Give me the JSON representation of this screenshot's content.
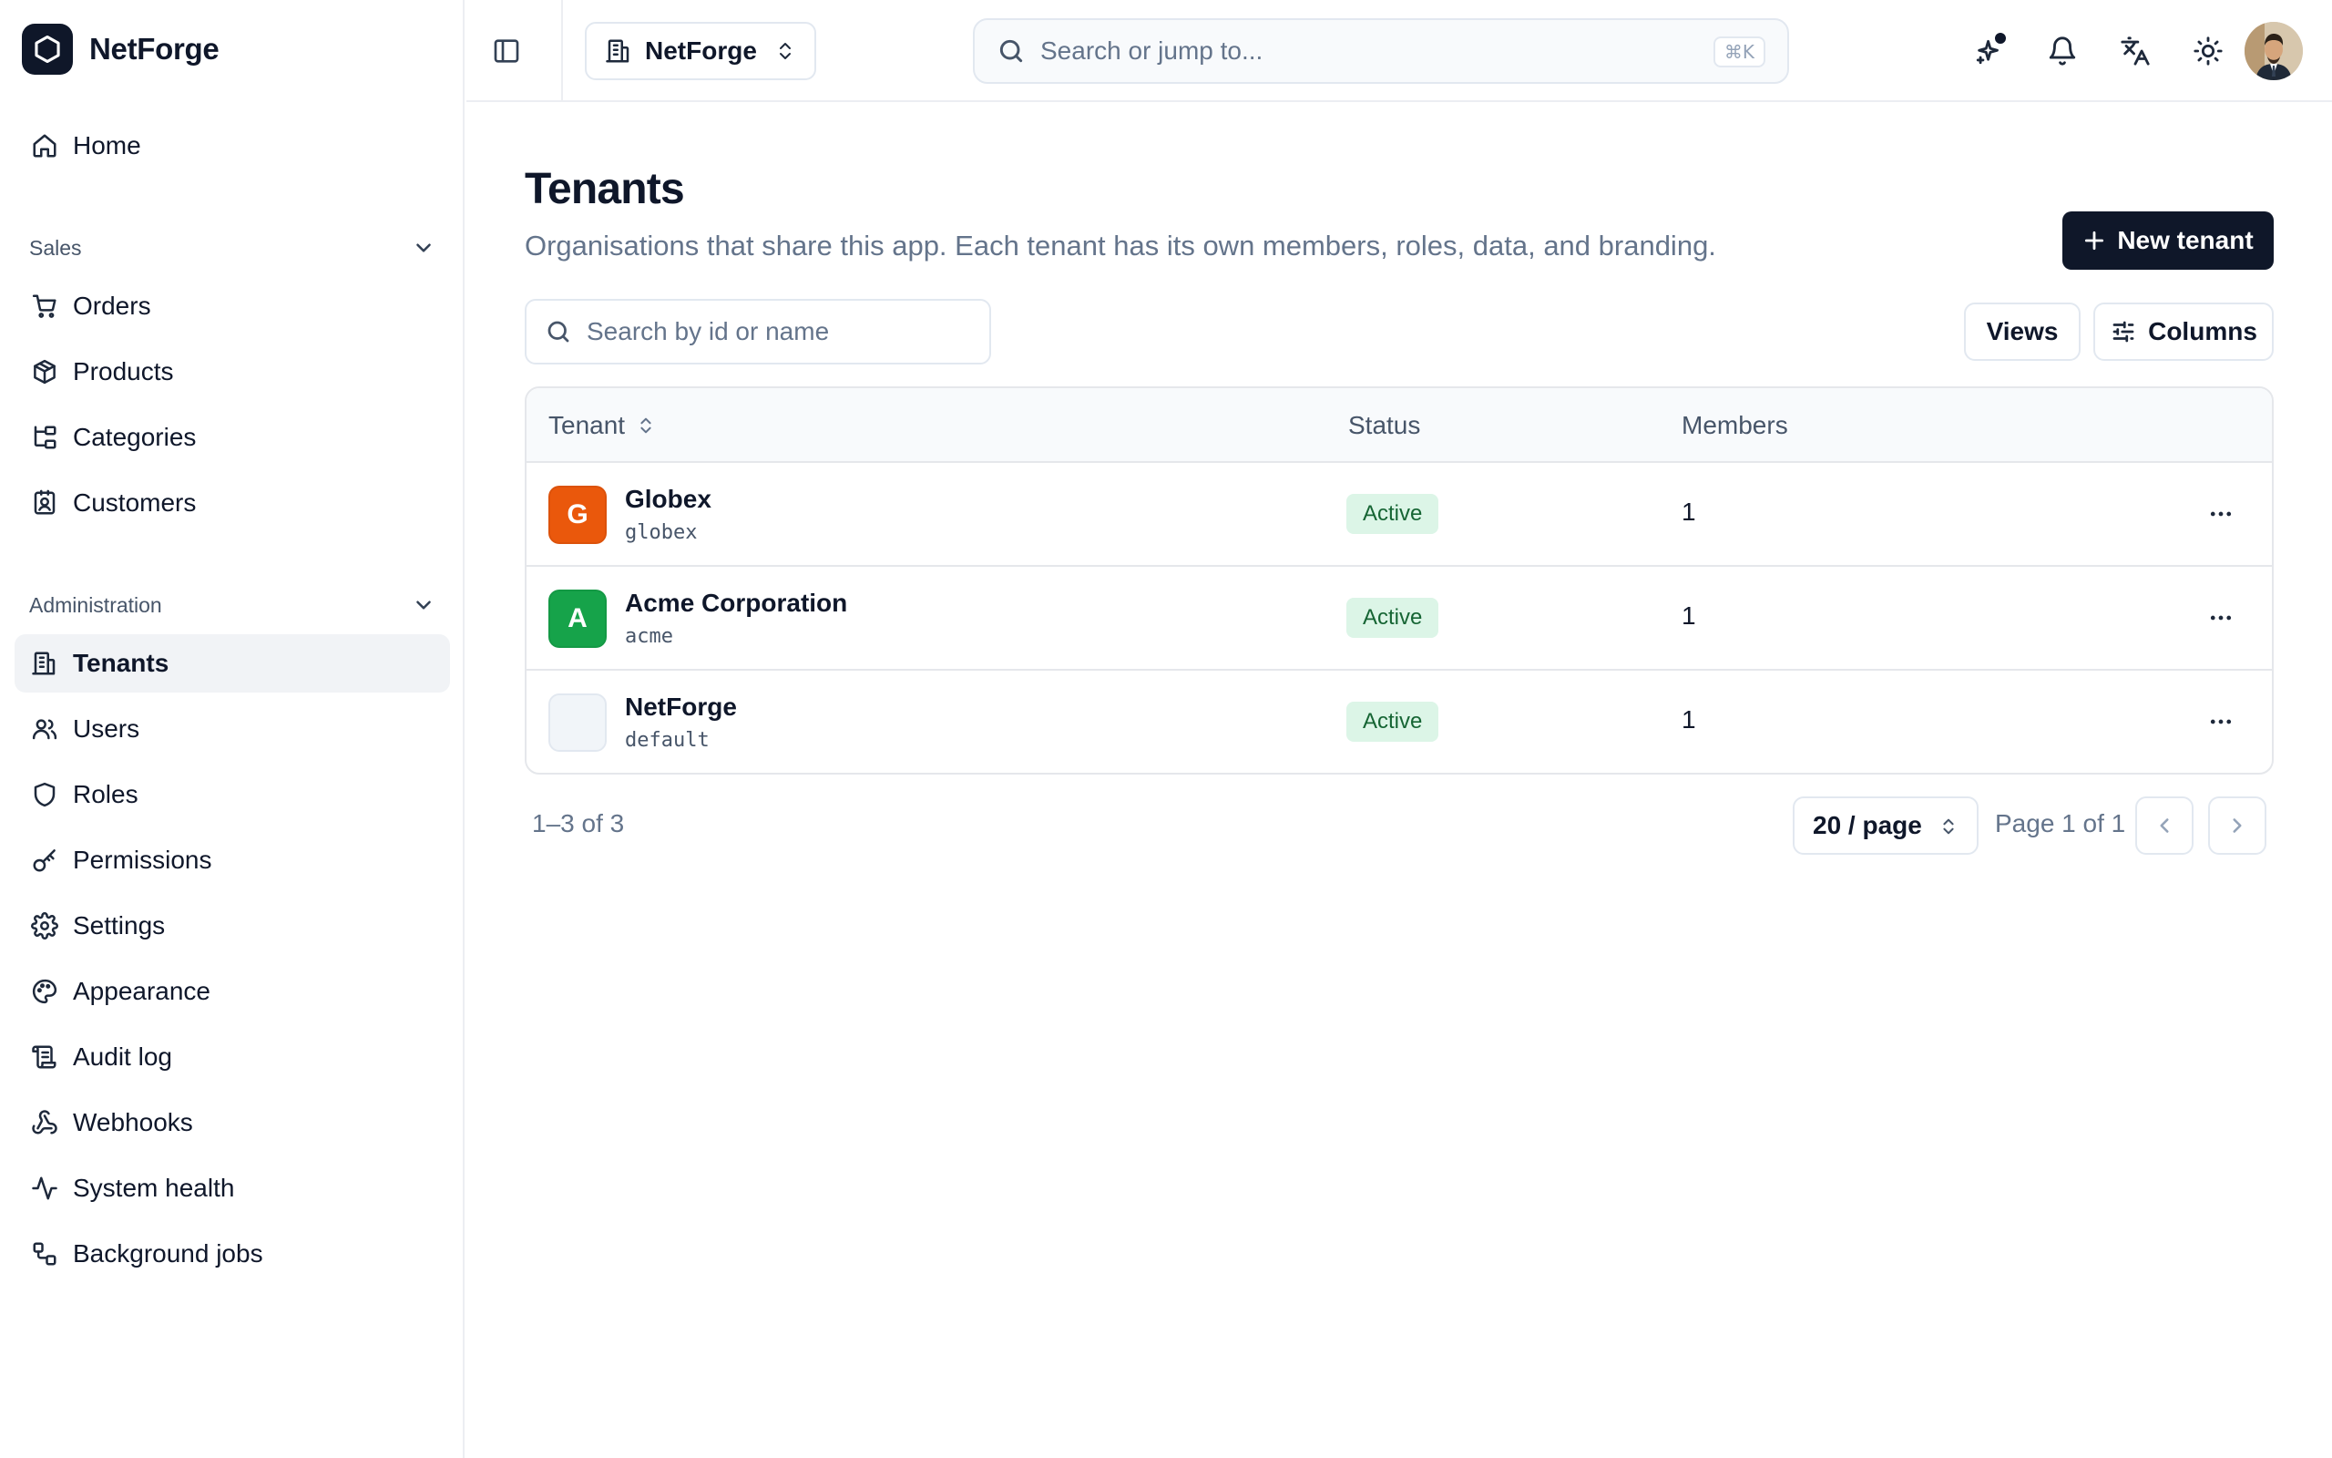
{
  "app": {
    "name": "NetForge"
  },
  "sidebar": {
    "home": {
      "label": "Home",
      "icon": "home-icon"
    },
    "sections": [
      {
        "label": "Sales",
        "items": [
          {
            "label": "Orders",
            "icon": "cart-icon"
          },
          {
            "label": "Products",
            "icon": "package-icon"
          },
          {
            "label": "Categories",
            "icon": "folder-tree-icon"
          },
          {
            "label": "Customers",
            "icon": "contact-icon"
          }
        ]
      },
      {
        "label": "Administration",
        "items": [
          {
            "label": "Tenants",
            "icon": "building-icon",
            "active": true
          },
          {
            "label": "Users",
            "icon": "users-icon"
          },
          {
            "label": "Roles",
            "icon": "shield-icon"
          },
          {
            "label": "Permissions",
            "icon": "key-icon"
          },
          {
            "label": "Settings",
            "icon": "gear-icon"
          },
          {
            "label": "Appearance",
            "icon": "palette-icon"
          },
          {
            "label": "Audit log",
            "icon": "scroll-icon"
          },
          {
            "label": "Webhooks",
            "icon": "webhook-icon"
          },
          {
            "label": "System health",
            "icon": "activity-icon"
          },
          {
            "label": "Background jobs",
            "icon": "workflow-icon"
          }
        ]
      }
    ]
  },
  "topbar": {
    "tenant_switcher": "NetForge",
    "search_placeholder": "Search or jump to...",
    "search_shortcut": "⌘K",
    "icons": [
      "sparkles-icon",
      "bell-icon",
      "languages-icon",
      "sun-icon",
      "user-avatar"
    ]
  },
  "page": {
    "title": "Tenants",
    "subtitle": "Organisations that share this app. Each tenant has its own members, roles, data, and branding.",
    "new_button": "New tenant",
    "search_placeholder": "Search by id or name",
    "views_button": "Views",
    "columns_button": "Columns"
  },
  "table": {
    "columns": [
      "Tenant",
      "Status",
      "Members"
    ],
    "rows": [
      {
        "name": "Globex",
        "id": "globex",
        "initial": "G",
        "color": "#ea580c",
        "status": "Active",
        "members": "1"
      },
      {
        "name": "Acme Corporation",
        "id": "acme",
        "initial": "A",
        "color": "#16a34a",
        "status": "Active",
        "members": "1"
      },
      {
        "name": "NetForge",
        "id": "default",
        "initial": "",
        "color": "#f1f5f9",
        "status": "Active",
        "members": "1"
      }
    ]
  },
  "pagination": {
    "range": "1–3 of 3",
    "page_size": "20 / page",
    "page_indicator": "Page 1 of 1"
  },
  "colors": {
    "primary": "#0f1729",
    "badge_bg": "#dcf5e7",
    "badge_text": "#166534"
  }
}
